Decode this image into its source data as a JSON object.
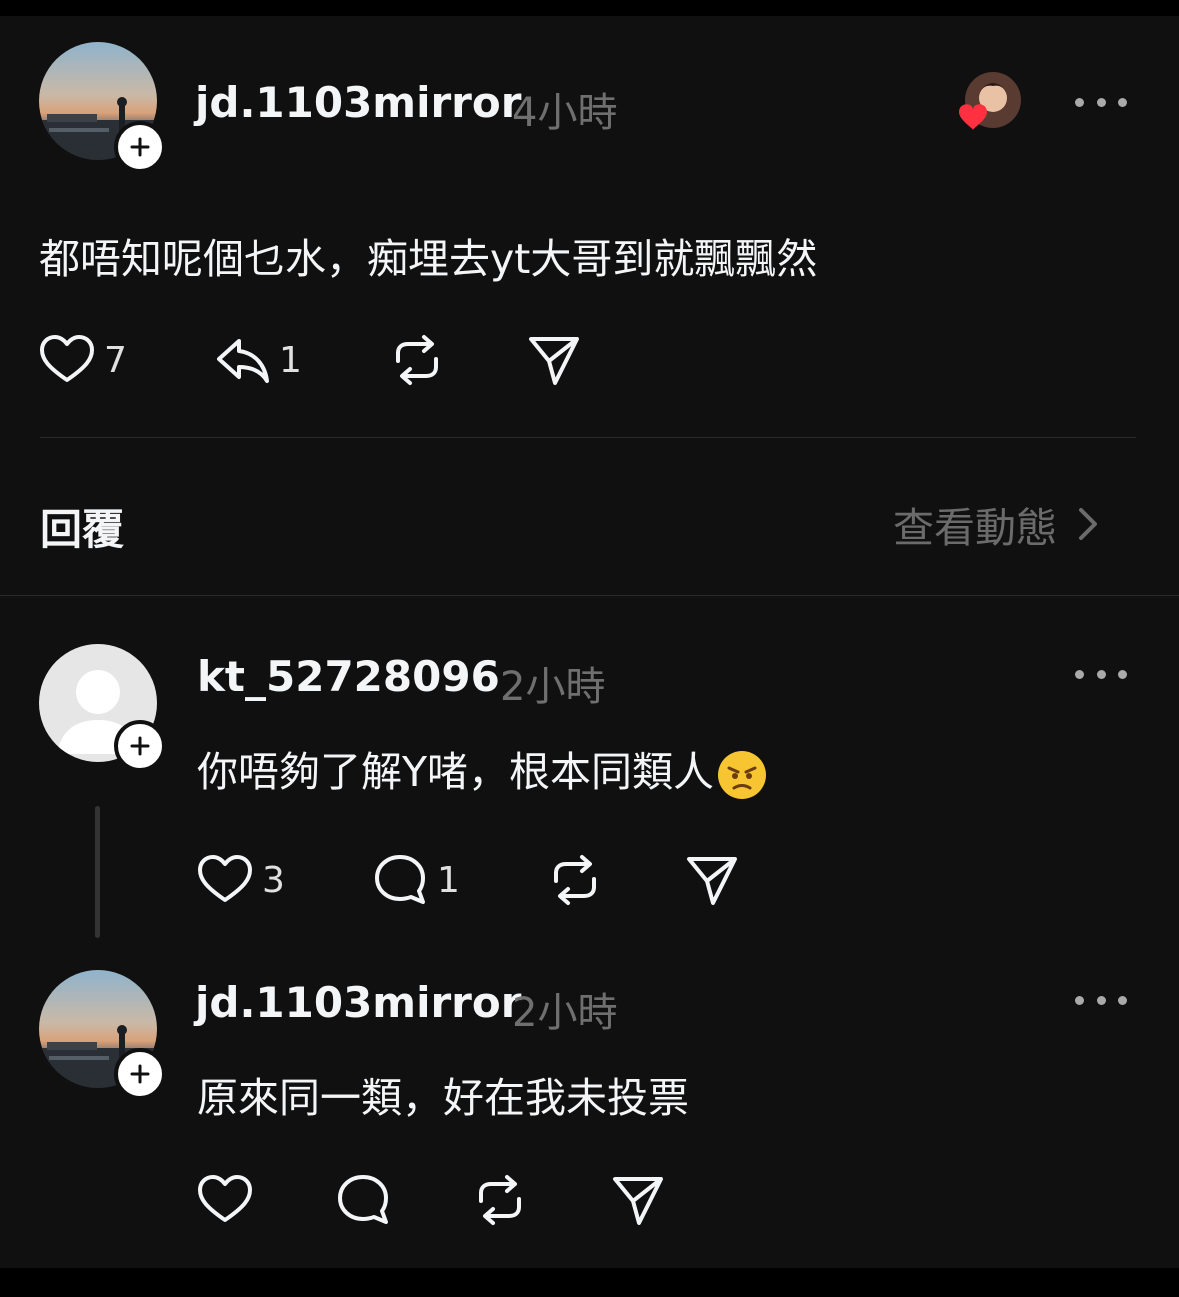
{
  "post": {
    "username": "jd.1103mirror",
    "time": "4小時",
    "text": "都唔知呢個乜水，痴埋去yt大哥到就飄飄然",
    "likes": "7",
    "replies": "1",
    "icons": [
      "avatar",
      "follow-plus-icon",
      "liker-avatar",
      "heart-badge-icon",
      "more-icon",
      "heart-icon",
      "reply-icon",
      "repost-icon",
      "share-icon"
    ]
  },
  "replies_header": {
    "label": "回覆",
    "view_activity": "查看動態"
  },
  "comments": [
    {
      "username": "kt_52728096",
      "time": "2小時",
      "text": "你唔夠了解Y啫，根本同類人",
      "emoji": "angry-face-emoji",
      "likes": "3",
      "replies": "1"
    },
    {
      "username": "jd.1103mirror",
      "time": "2小時",
      "text": "原來同一類，好在我未投票",
      "likes": "",
      "replies": ""
    }
  ],
  "colors": {
    "background": "#101010",
    "text": "#f3f5f7",
    "muted": "#6f6f6f",
    "heart": "#ff3040"
  }
}
